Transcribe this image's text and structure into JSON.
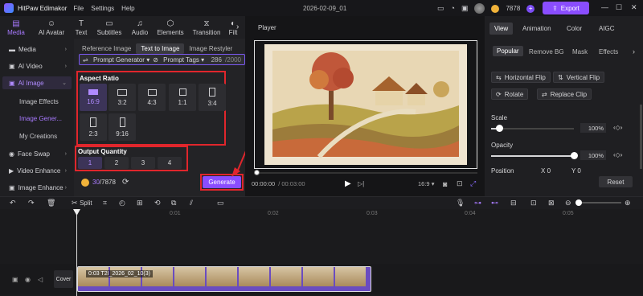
{
  "app": {
    "title": "HitPaw Edimakor",
    "menus": [
      "File",
      "Settings",
      "Help"
    ],
    "doc_title": "2026-02-09_01",
    "credits": "7878",
    "export_label": "Export"
  },
  "top_tabs": [
    {
      "label": "Media",
      "icon": "media-icon"
    },
    {
      "label": "AI Avatar",
      "icon": "avatar-icon"
    },
    {
      "label": "Text",
      "icon": "text-icon"
    },
    {
      "label": "Subtitles",
      "icon": "subtitles-icon"
    },
    {
      "label": "Audio",
      "icon": "audio-icon"
    },
    {
      "label": "Elements",
      "icon": "elements-icon"
    },
    {
      "label": "Transition",
      "icon": "transition-icon"
    },
    {
      "label": "Filt",
      "icon": "filter-icon"
    }
  ],
  "left_nav": {
    "media": "Media",
    "ai_video": "AI Video",
    "ai_image": "AI Image",
    "image_effects": "Image Effects",
    "image_gen": "Image Gener...",
    "my_creations": "My Creations",
    "face_swap": "Face Swap",
    "video_enhance": "Video Enhance",
    "image_enhance": "Image Enhance"
  },
  "sub_tabs": [
    "Reference Image",
    "Text to Image",
    "Image Restyler"
  ],
  "generator": {
    "prompt_generator": "Prompt Generator",
    "prompt_tags": "Prompt Tags",
    "count": "286",
    "max": "/2000"
  },
  "aspect": {
    "title": "Aspect Ratio",
    "options": [
      "16:9",
      "3:2",
      "4:3",
      "1:1",
      "3:4",
      "2:3",
      "9:16"
    ],
    "selected": "16:9"
  },
  "quantity": {
    "title": "Output Quantity",
    "options": [
      "1",
      "2",
      "3",
      "4"
    ],
    "selected": "1"
  },
  "footer": {
    "credits_used": "30",
    "credits_total": "/7878",
    "generate": "Generate"
  },
  "player": {
    "label": "Player",
    "time_current": "00:00:00",
    "time_total": "/ 00:03:00",
    "ratio": "16:9"
  },
  "right_panel": {
    "tabs": [
      "View",
      "Animation",
      "Color",
      "AIGC"
    ],
    "subtabs": [
      "Popular",
      "Remove BG",
      "Mask",
      "Effects"
    ],
    "buttons": {
      "hflip": "Horizontal Flip",
      "vflip": "Vertical Flip",
      "rotate": "Rotate",
      "replace": "Replace Clip"
    },
    "scale": {
      "label": "Scale",
      "value": "100%",
      "level": 0.1
    },
    "opacity": {
      "label": "Opacity",
      "value": "100%",
      "level": 1.0
    },
    "position": {
      "label": "Position",
      "x": "0",
      "y": "0"
    },
    "reset": "Reset"
  },
  "timeline": {
    "split": "Split",
    "ticks": [
      "0:01",
      "0:02",
      "0:03",
      "0:04",
      "0:05"
    ],
    "cover": "Cover",
    "clip_label": "0:03  T2I_2026_02_10(3)"
  },
  "colors": {
    "accent": "#8a4dff",
    "highlight": "#e0262c",
    "active_text": "#a87aff"
  }
}
